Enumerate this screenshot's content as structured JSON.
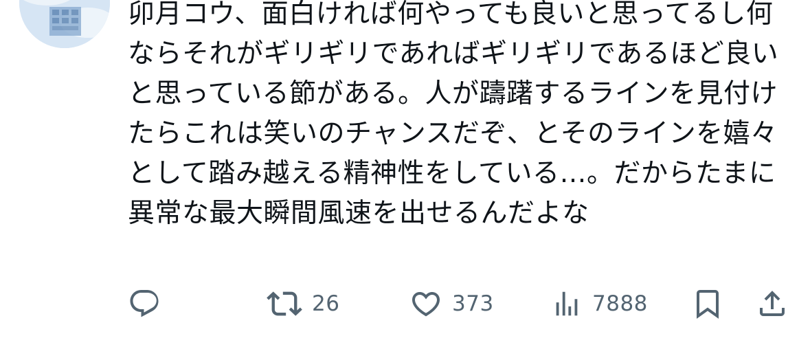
{
  "tweet": {
    "text": "卯月コウ、面白ければ何やっても良いと思ってるし何ならそれがギリギリであればギリギリであるほど良いと思っている節がある。人が躊躇するラインを見付けたらこれは笑いのチャンスだぞ、とそのラインを嬉々として踏み越える精神性をしている…。だからたまに異常な最大瞬間風速を出せるんだよな"
  },
  "actions": {
    "reply": {
      "icon": "reply-icon"
    },
    "retweet": {
      "icon": "retweet-icon",
      "count": "26"
    },
    "like": {
      "icon": "heart-icon",
      "count": "373"
    },
    "views": {
      "icon": "analytics-icon",
      "count": "7888"
    },
    "bookmark": {
      "icon": "bookmark-icon"
    },
    "share": {
      "icon": "share-icon"
    }
  },
  "colors": {
    "text": "#0f1419",
    "icon": "#536471",
    "avatar_bg": "#cfe0f2"
  }
}
